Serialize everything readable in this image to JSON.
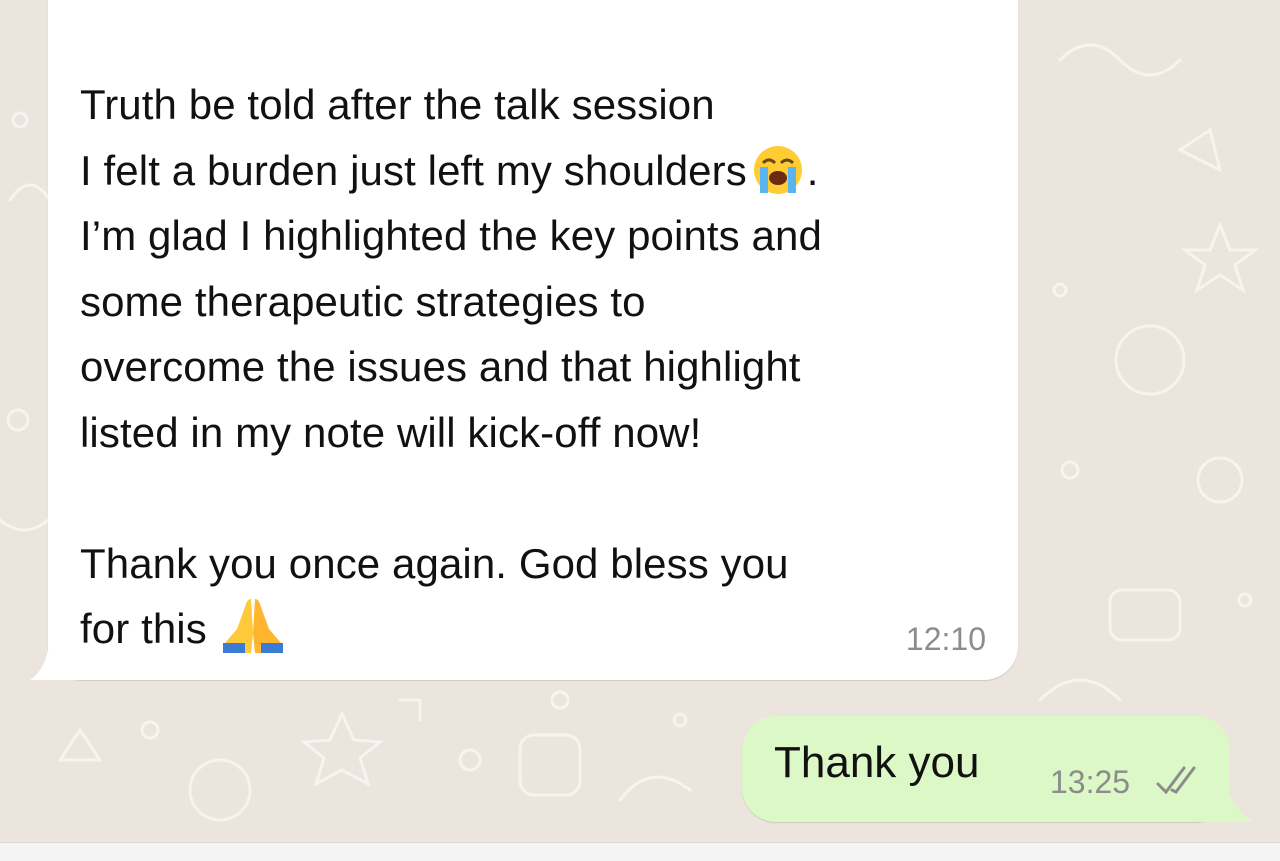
{
  "colors": {
    "wallpaper": "#ECE5DD",
    "incoming_bubble": "#FFFFFF",
    "outgoing_bubble": "#DCF8C6",
    "timestamp": "#8C8C8C",
    "text": "#111111"
  },
  "messages": {
    "incoming": {
      "lines": [
        "Truth be told after the talk session",
        "I felt a burden just left my shoulders",
        ".",
        "I’m glad I highlighted the key points and",
        "some therapeutic strategies to",
        "overcome the issues and that highlight",
        "listed in my note will kick-off now!",
        "",
        "Thank you once again. God bless you",
        "for this "
      ],
      "emoji_1": "crying-face-emoji",
      "emoji_2": "folded-hands-emoji",
      "time": "12:10"
    },
    "outgoing": {
      "text": "Thank you",
      "time": "13:25",
      "status_icon": "double-check-read-icon"
    }
  }
}
